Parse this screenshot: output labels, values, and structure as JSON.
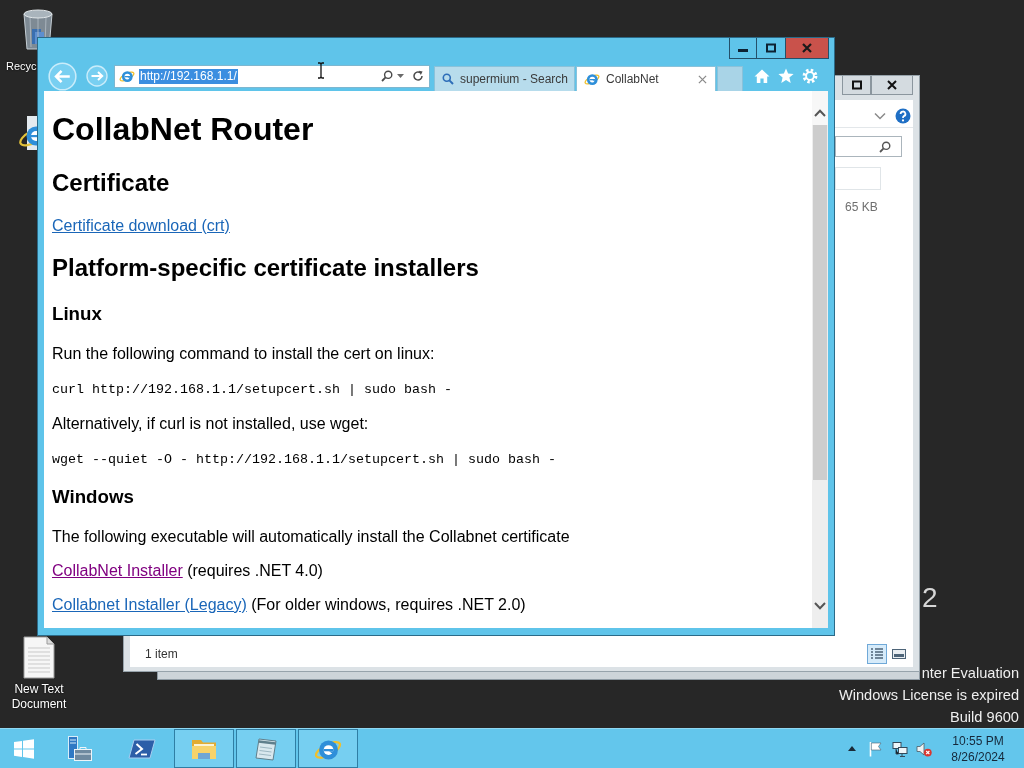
{
  "desktop": {
    "icons": [
      {
        "kind": "recycle-bin",
        "label": "Recyc"
      },
      {
        "kind": "browser"
      },
      {
        "kind": "text-file",
        "label": "New Text Document"
      }
    ],
    "watermark": {
      "fragment": "2",
      "lines": [
        "nter Evaluation",
        "Windows License is expired",
        "Build 9600"
      ]
    }
  },
  "explorer_window": {
    "size_text": "65 KB",
    "status_text": "1 item",
    "views": [
      {
        "kind": "details",
        "selected": true
      },
      {
        "kind": "large-icons",
        "selected": false
      }
    ]
  },
  "browser_window": {
    "address": "http://192.168.1.1/",
    "address_selected": true,
    "tabs": [
      {
        "kind": "search",
        "label": "supermium - Search",
        "selected": false
      },
      {
        "kind": "page",
        "label": "CollabNet",
        "selected": true
      }
    ],
    "page": [
      {
        "kind": "h1",
        "text": "CollabNet Router"
      },
      {
        "kind": "h2",
        "text": "Certificate"
      },
      {
        "kind": "link",
        "link": "Certificate download (crt)",
        "visited": false
      },
      {
        "kind": "h2",
        "text": "Platform-specific certificate installers"
      },
      {
        "kind": "h3",
        "text": "Linux"
      },
      {
        "kind": "text",
        "text": "Run the following command to install the cert on linux:"
      },
      {
        "kind": "code",
        "text": "curl http://192.168.1.1/setupcert.sh | sudo bash -"
      },
      {
        "kind": "text",
        "text": "Alternatively, if curl is not installed, use wget:"
      },
      {
        "kind": "code",
        "text": "wget --quiet -O - http://192.168.1.1/setupcert.sh | sudo bash -"
      },
      {
        "kind": "h3",
        "text": "Windows"
      },
      {
        "kind": "text",
        "text": "The following executable will automatically install the Collabnet certificate"
      },
      {
        "kind": "link",
        "link": "CollabNet Installer",
        "visited": true,
        "rest": "(requires .NET 4.0)"
      },
      {
        "kind": "link",
        "link": "Collabnet Installer (Legacy)",
        "visited": false,
        "rest": "(For older windows, requires .NET 2.0)"
      }
    ]
  },
  "taskbar": {
    "apps": [
      {
        "kind": "start",
        "running": false
      },
      {
        "kind": "server-manager",
        "running": false
      },
      {
        "kind": "powershell",
        "running": false
      },
      {
        "kind": "file-explorer",
        "running": true
      },
      {
        "kind": "notepad",
        "running": true
      },
      {
        "kind": "internet-explorer",
        "running": true
      }
    ],
    "clock": {
      "time": "10:55 PM",
      "date": "8/26/2024"
    }
  }
}
